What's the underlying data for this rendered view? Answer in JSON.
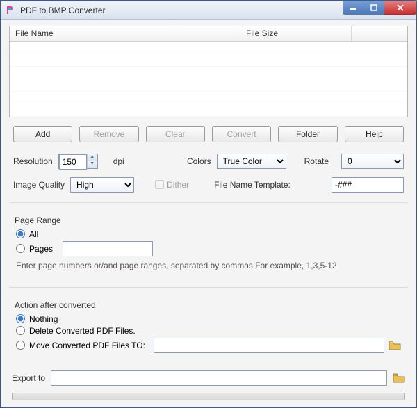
{
  "window": {
    "title": "PDF to BMP Converter"
  },
  "table": {
    "col_filename": "File Name",
    "col_filesize": "File Size"
  },
  "buttons": {
    "add": "Add",
    "remove": "Remove",
    "clear": "Clear",
    "convert": "Convert",
    "folder": "Folder",
    "help": "Help"
  },
  "settings": {
    "resolution_label": "Resolution",
    "resolution_value": "150",
    "dpi_label": "dpi",
    "colors_label": "Colors",
    "colors_value": "True Color",
    "colors_options": [
      "True Color"
    ],
    "rotate_label": "Rotate",
    "rotate_value": "0",
    "rotate_options": [
      "0"
    ],
    "quality_label": "Image Quality",
    "quality_value": "High",
    "quality_options": [
      "High"
    ],
    "dither_label": "Dither",
    "template_label": "File Name Template:",
    "template_value": "-###"
  },
  "page_range": {
    "title": "Page Range",
    "all_label": "All",
    "pages_label": "Pages",
    "pages_value": "",
    "hint": "Enter page numbers or/and page ranges, separated by commas,For example, 1,3,5-12"
  },
  "action": {
    "title": "Action after converted",
    "nothing_label": "Nothing",
    "delete_label": "Delete Converted PDF Files.",
    "move_label": "Move Converted PDF Files TO:",
    "move_path": ""
  },
  "export": {
    "label": "Export to",
    "value": ""
  }
}
